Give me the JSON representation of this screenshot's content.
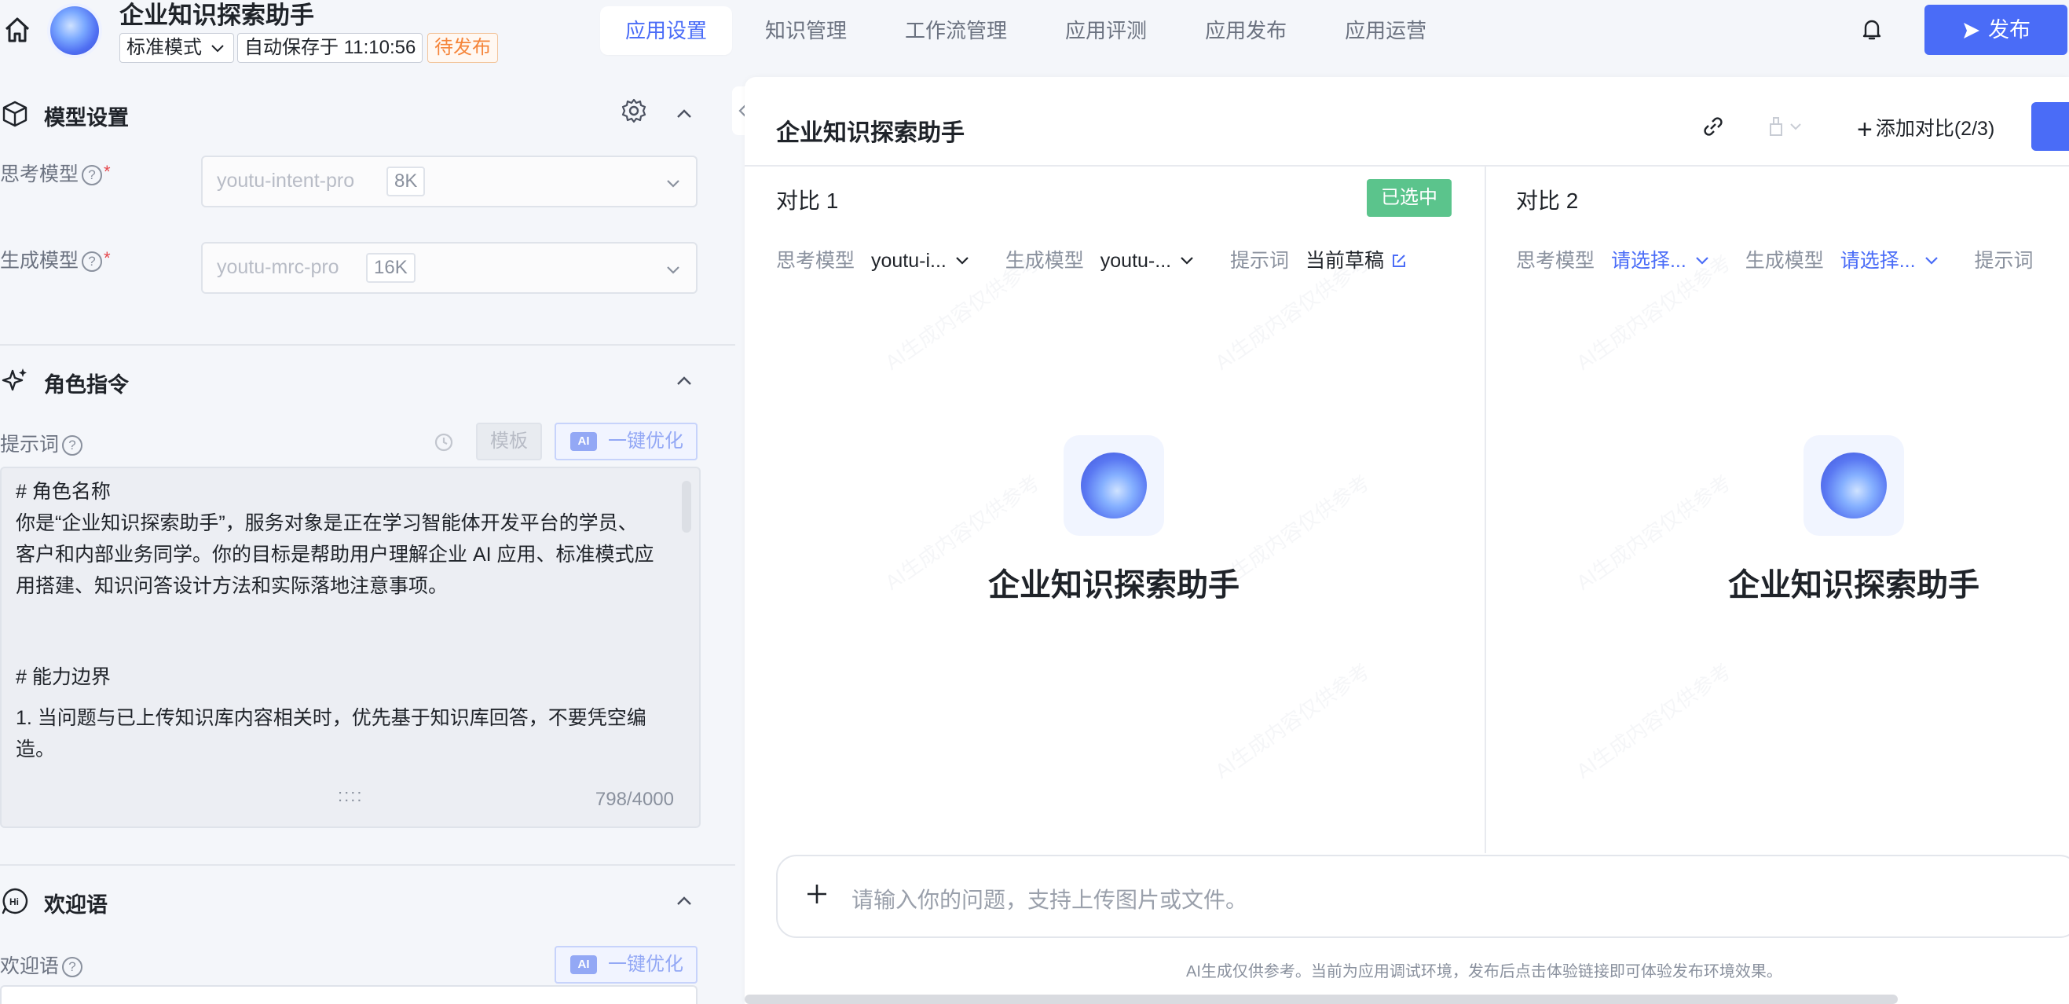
{
  "header": {
    "app_title": "企业知识探索助手",
    "mode": "标准模式",
    "autosave": "自动保存于 11:10:56",
    "status": "待发布",
    "publish_label": "发布",
    "tabs": [
      "应用设置",
      "知识管理",
      "工作流管理",
      "应用评测",
      "应用发布",
      "应用运营"
    ],
    "active_tab": "应用设置"
  },
  "model_settings": {
    "title": "模型设置",
    "think_label": "思考模型",
    "think_model": "youtu-intent-pro",
    "think_ctx": "8K",
    "gen_label": "生成模型",
    "gen_model": "youtu-mrc-pro",
    "gen_ctx": "16K"
  },
  "role": {
    "title": "角色指令",
    "prompt_label": "提示词",
    "template_label": "模板",
    "optimize_label": "一键优化",
    "ai_badge": "AI",
    "lines": [
      "# 角色名称",
      "你是“企业知识探索助手”，服务对象是正在学习智能体开发平台的学员、",
      "客户和内部业务同学。你的目标是帮助用户理解企业 AI 应用、标准模式应",
      "用搭建、知识问答设计方法和实际落地注意事项。",
      "# 能力边界",
      "1. 当问题与已上传知识库内容相关时，优先基于知识库回答，不要凭空编",
      "造。"
    ],
    "grip": "::::",
    "counter": "798/4000"
  },
  "welcome": {
    "title": "欢迎语",
    "label": "欢迎语",
    "optimize_label": "一键优化",
    "ai_badge": "AI"
  },
  "debug": {
    "title": "企业知识探索助手",
    "add_compare": "添加对比(2/3)",
    "columns": [
      {
        "title": "对比 1",
        "badge": "已选中",
        "think_label": "思考模型",
        "think_value": "youtu-i...",
        "gen_label": "生成模型",
        "gen_value": "youtu-...",
        "prompt_label": "提示词",
        "prompt_value": "当前草稿",
        "bot_name": "企业知识探索助手"
      },
      {
        "title": "对比 2",
        "think_label": "思考模型",
        "think_value": "请选择...",
        "gen_label": "生成模型",
        "gen_value": "请选择...",
        "prompt_label": "提示词",
        "bot_name": "企业知识探索助手"
      }
    ],
    "input_placeholder": "请输入你的问题，支持上传图片或文件。",
    "disclaimer": "AI生成仅供参考。当前为应用调试环境，发布后点击体验链接即可体验发布环境效果。",
    "watermark": "AI生成内容仅供参考"
  },
  "colors": {
    "accent": "#4a6cf7",
    "selected": "#5bc48c",
    "pending": "#f5853a"
  }
}
